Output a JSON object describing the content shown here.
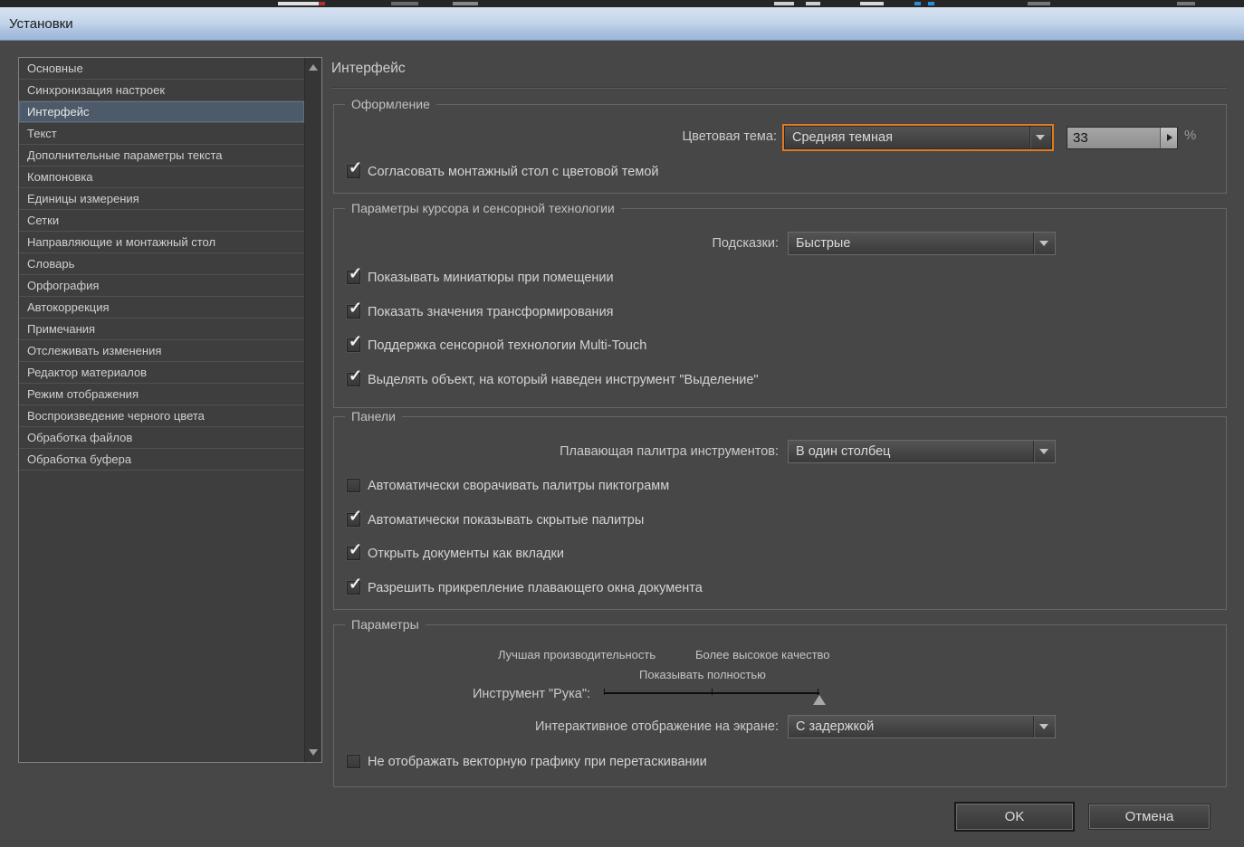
{
  "window": {
    "title": "Установки"
  },
  "sidebar": {
    "selected": "Интерфейс",
    "items": [
      "Основные",
      "Синхронизация настроек",
      "Интерфейс",
      "Текст",
      "Дополнительные параметры текста",
      "Компоновка",
      "Единицы измерения",
      "Сетки",
      "Направляющие и монтажный стол",
      "Словарь",
      "Орфография",
      "Автокоррекция",
      "Примечания",
      "Отслеживать изменения",
      "Редактор материалов",
      "Режим отображения",
      "Воспроизведение черного цвета",
      "Обработка файлов",
      "Обработка буфера"
    ]
  },
  "page": {
    "heading": "Интерфейс"
  },
  "appearance": {
    "legend": "Оформление",
    "color_theme_label": "Цветовая тема:",
    "color_theme_value": "Средняя темная",
    "brightness_value": "33",
    "percent_sign": "%",
    "match_canvas": {
      "label": "Согласовать монтажный стол с цветовой темой",
      "checked": true
    }
  },
  "cursor_touch": {
    "legend": "Параметры курсора и сенсорной технологии",
    "tooltips_label": "Подсказки:",
    "tooltips_value": "Быстрые",
    "items": [
      {
        "label": "Показывать миниатюры при помещении",
        "checked": true
      },
      {
        "label": "Показать значения трансформирования",
        "checked": true
      },
      {
        "label": "Поддержка сенсорной технологии Multi-Touch",
        "checked": true
      },
      {
        "label": "Выделять объект, на который наведен инструмент \"Выделение\"",
        "checked": true
      }
    ]
  },
  "panels": {
    "legend": "Панели",
    "floating_palette_label": "Плавающая палитра инструментов:",
    "floating_palette_value": "В один столбец",
    "items": [
      {
        "label": "Автоматически сворачивать палитры пиктограмм",
        "checked": false
      },
      {
        "label": "Автоматически показывать скрытые палитры",
        "checked": true
      },
      {
        "label": "Открыть документы как вкладки",
        "checked": true
      },
      {
        "label": "Разрешить прикрепление плавающего окна документа",
        "checked": true
      }
    ]
  },
  "options": {
    "legend": "Параметры",
    "best_performance_label": "Лучшая производительность",
    "higher_quality_label": "Более высокое качество",
    "show_full_label": "Показывать полностью",
    "hand_tool_label": "Инструмент \"Рука\":",
    "hand_tool_slider_percent": 100,
    "interactive_label": "Интерактивное отображение на экране:",
    "interactive_value": "С задержкой",
    "no_vector_drag": {
      "label": "Не отображать векторную графику при перетаскивании",
      "checked": false
    }
  },
  "footer": {
    "ok": "OK",
    "cancel": "Отмена"
  },
  "icons": {
    "check": "✓"
  },
  "colors": {
    "focus_orange": "#E1791F",
    "titlebar_blue_top": "#D6E2F2",
    "titlebar_blue_bottom": "#9DB6D7",
    "selection_bg": "#4D5A69",
    "dialog_bg": "#474747"
  }
}
